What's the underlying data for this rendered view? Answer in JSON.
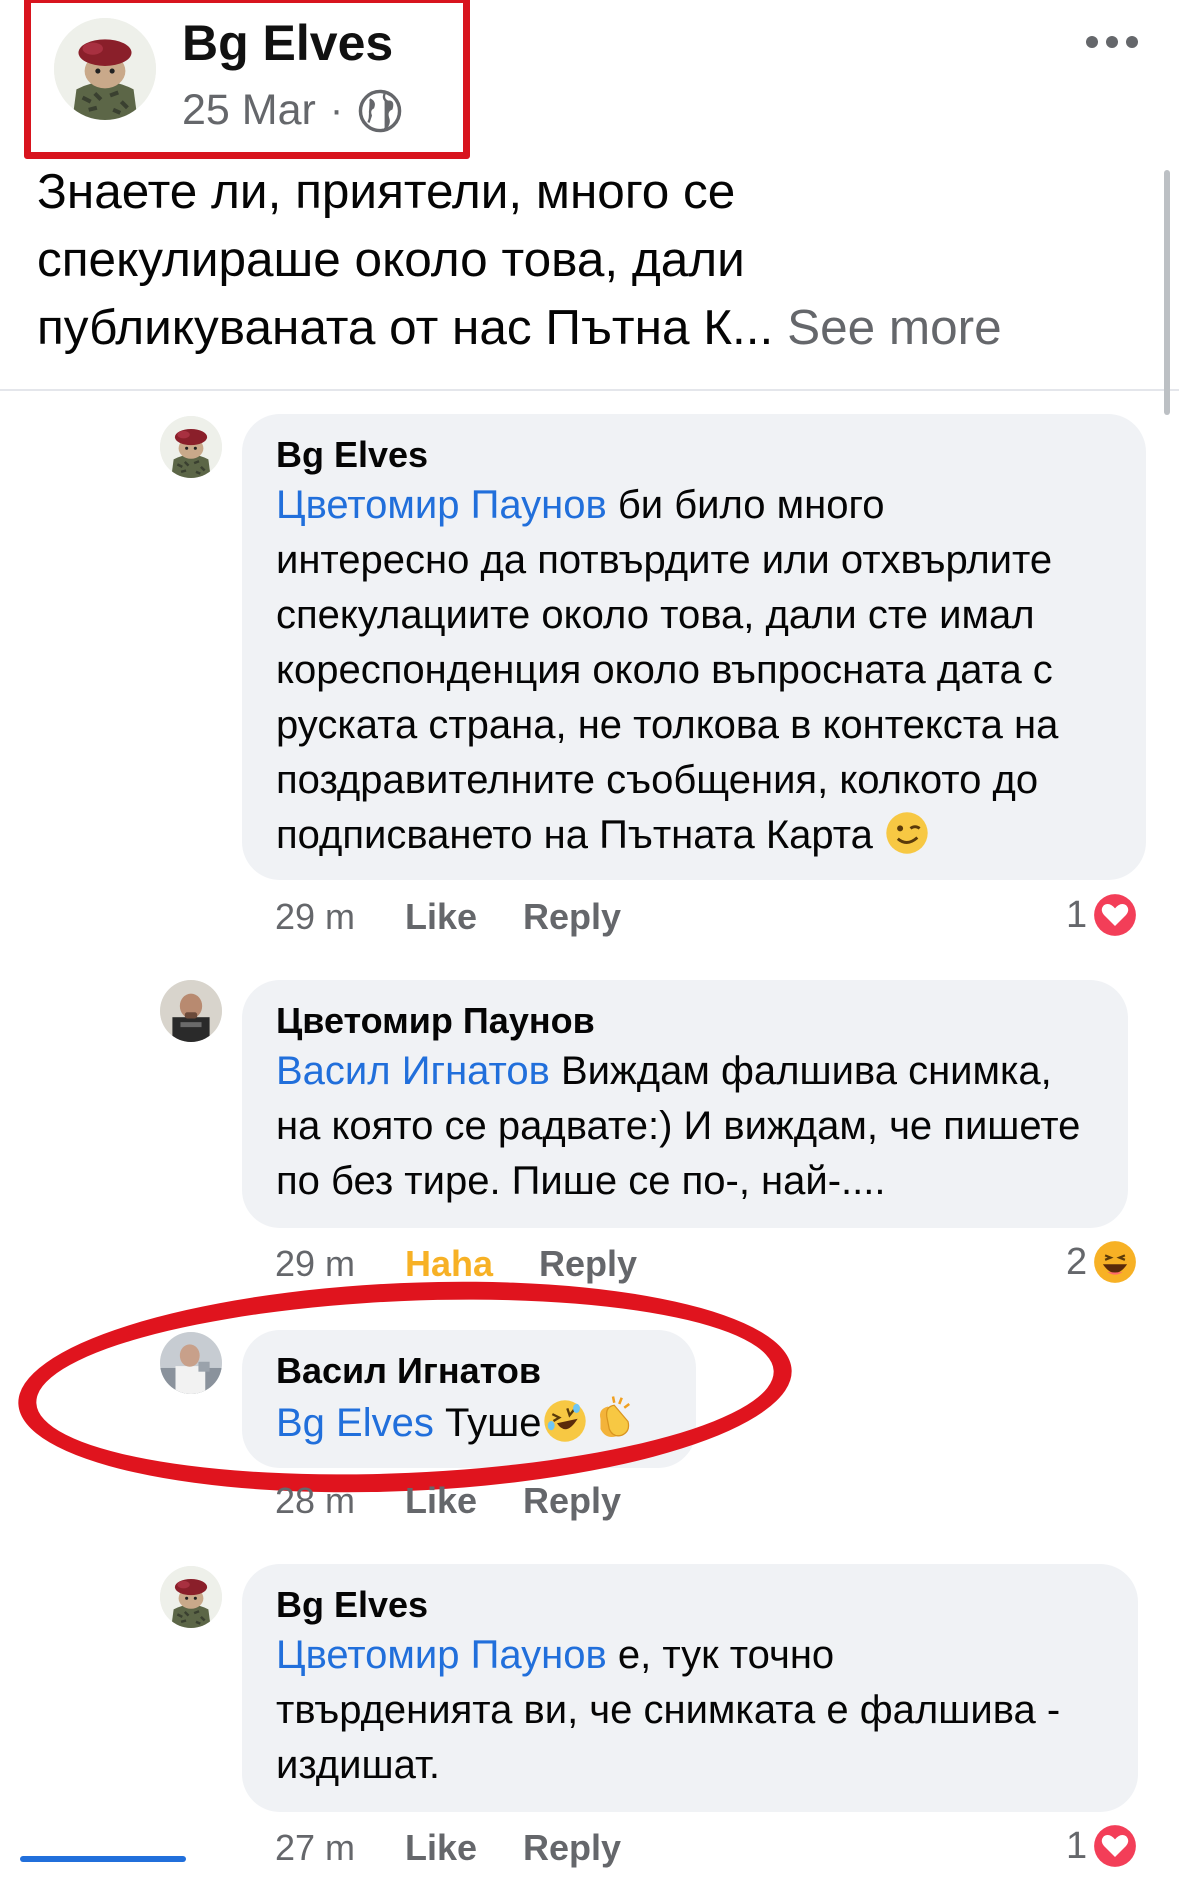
{
  "post": {
    "author": "Bg Elves",
    "date": "25 Mar",
    "separator": "·",
    "privacy_icon": "globe-icon",
    "more_icon": "more-horizontal-icon",
    "text_line1": "Знаете ли, приятели, много се",
    "text_line2": "спекулираше около това, дали",
    "text_line3": "публикуваната от нас Пътна К...",
    "see_more": "See more"
  },
  "comments": [
    {
      "author": "Bg Elves",
      "mention": "Цветомир Паунов",
      "text_first": " би било много",
      "text_rest": "интересно да потвърдите или отхвърлите спекулациите около това, дали сте имал кореспонденция около въпросната дата с руската страна, не толкова в контекста на поздравителните съобщения, колкото до подписването на Пътната Карта",
      "emoji": "winking-face",
      "time": "29 m",
      "action1": "Like",
      "action2": "Reply",
      "reaction_count": "1",
      "reaction_icon": "love-reaction-icon"
    },
    {
      "author": "Цветомир Паунов",
      "mention": "Васил Игнатов",
      "text_first": " Виждам фалшива снимка,",
      "text_rest": "на която се радвате:) И виждам, че пишете по без тире. Пише се по-, най-....",
      "time": "29 m",
      "action1": "Haha",
      "action2": "Reply",
      "reaction_count": "2",
      "reaction_icon": "haha-reaction-icon"
    },
    {
      "author": "Васил Игнатов",
      "mention": "Bg Elves",
      "text_first": " Туше",
      "emoji": [
        "rolling-on-floor-laughing",
        "clapping-hands"
      ],
      "time": "28 m",
      "action1": "Like",
      "action2": "Reply"
    },
    {
      "author": "Bg Elves",
      "mention": "Цветомир Паунов",
      "text_first": " е, тук точно",
      "text_rest": "твърденията ви, че снимката е фалшива - издишат.",
      "time": "27 m",
      "action1": "Like",
      "action2": "Reply",
      "reaction_count": "1",
      "reaction_icon": "love-reaction-icon"
    }
  ],
  "colors": {
    "mention": "#216fdb",
    "highlight": "#e0141e",
    "haha": "#f7b125",
    "love": "#f33e58"
  }
}
